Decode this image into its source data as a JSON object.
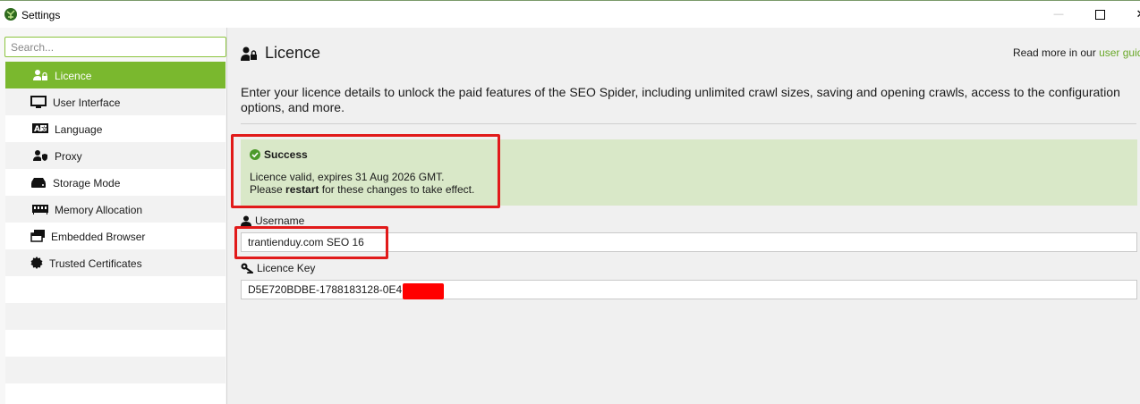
{
  "window": {
    "title": "Settings",
    "min_glyph": "—",
    "max_glyph": "☐",
    "close_glyph": "✕"
  },
  "search": {
    "placeholder": "Search..."
  },
  "sidebar": {
    "items": [
      {
        "label": "Licence",
        "icon": "licence-user-lock-icon",
        "active": true
      },
      {
        "label": "User Interface",
        "icon": "monitor-icon",
        "active": false
      },
      {
        "label": "Language",
        "icon": "language-icon",
        "active": false
      },
      {
        "label": "Proxy",
        "icon": "proxy-user-shield-icon",
        "active": false
      },
      {
        "label": "Storage Mode",
        "icon": "hard-drive-icon",
        "active": false
      },
      {
        "label": "Memory Allocation",
        "icon": "memory-chip-icon",
        "active": false
      },
      {
        "label": "Embedded Browser",
        "icon": "browser-windows-icon",
        "active": false
      },
      {
        "label": "Trusted Certificates",
        "icon": "certificate-badge-icon",
        "active": false
      }
    ]
  },
  "main": {
    "title": "Licence",
    "read_more_prefix": "Read more in our",
    "read_more_link": "user guide",
    "intro": "Enter your licence details to unlock the paid features of the SEO Spider, including unlimited crawl sizes, saving and opening crawls, access to the configuration options, and more.",
    "success": {
      "heading": "Success",
      "line1": "Licence valid, expires 31 Aug 2026 GMT.",
      "line2_prefix": "Please",
      "line2_bold": "restart",
      "line2_suffix": "for these changes to take effect."
    },
    "username": {
      "label": "Username",
      "value": "trantienduy.com SEO 16"
    },
    "licence_key": {
      "label": "Licence Key",
      "value": "D5E720BDBE-1788183128-0E41"
    }
  },
  "colors": {
    "accent": "#7ab82e",
    "link": "#6aa82a",
    "success_bg": "#d9e8c8",
    "highlight": "#e11a1a",
    "redaction": "#ff0000"
  }
}
